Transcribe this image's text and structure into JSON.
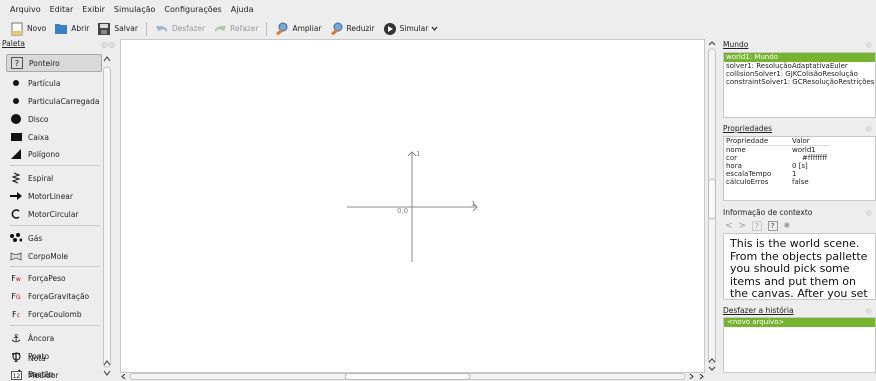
{
  "menu": [
    "Arquivo",
    "Editar",
    "Exibir",
    "Simulação",
    "Configurações",
    "Ajuda"
  ],
  "toolbar": {
    "novo": "Novo",
    "abrir": "Abrir",
    "salvar": "Salvar",
    "desfazer": "Desfazer",
    "refazer": "Refazer",
    "ampliar": "Ampliar",
    "reduzir": "Reduzir",
    "simular": "Simular"
  },
  "palette": {
    "title": "Paleta",
    "items": [
      "Ponteiro",
      "Partícula",
      "ParticulaCarregada",
      "Disco",
      "Caixa",
      "Polígono",
      "Espiral",
      "MotorLinear",
      "MotorCircular",
      "Gás",
      "CorpoMole",
      "ForçaPeso",
      "ForçaGravitação",
      "ForçaCoulomb",
      "Âncora",
      "Ponto",
      "Bastão",
      "Nota",
      "Medidor"
    ]
  },
  "canvas": {
    "origin": "0,0",
    "x_tick": "1",
    "y_tick": "1"
  },
  "world": {
    "title": "Mundo",
    "selected": "world1: Mundo",
    "lines": [
      "solver1: ResoluçãoAdaptativaEuler",
      "collisionSolver1: GJKColisãoResolução",
      "constraintSolver1: GCResoluçãoRestrições"
    ]
  },
  "properties": {
    "title": "Propriedades",
    "headers": [
      "Propriedade",
      "Valor"
    ],
    "rows": [
      [
        "nome",
        "world1"
      ],
      [
        "cor",
        "#ffffffff"
      ],
      [
        "hora",
        "0 [s]"
      ],
      [
        "escalaTempo",
        "1"
      ],
      [
        "cálculoErros",
        "false"
      ]
    ]
  },
  "context": {
    "title": "Informação de contexto",
    "text": "This is the world scene. From the objects pallette you should pick some items and put them on the canvas. After you set properties of objects you"
  },
  "undo": {
    "title": "Desfazer a história",
    "selected": "<novo arquivo>"
  }
}
